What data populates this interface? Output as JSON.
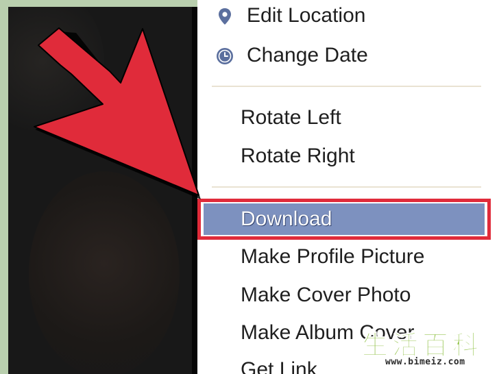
{
  "context_menu": {
    "location_items": [
      {
        "label": "Edit Location",
        "icon": "map-pin-icon"
      },
      {
        "label": "Change Date",
        "icon": "clock-icon"
      }
    ],
    "rotate_items": [
      {
        "label": "Rotate Left"
      },
      {
        "label": "Rotate Right"
      }
    ],
    "highlighted_item": {
      "label": "Download",
      "state": "selected"
    },
    "more_items": [
      {
        "label": "Make Profile Picture"
      },
      {
        "label": "Make Cover Photo"
      },
      {
        "label": "Make Album Cover"
      },
      {
        "label": "Get Link"
      }
    ]
  },
  "annotation": {
    "arrow_color": "#e02b3a",
    "highlight_border_color": "#e02b3a"
  },
  "colors": {
    "selected_background": "#7d91bf",
    "menu_text": "#1f1f1f",
    "background": "#b9cfae"
  },
  "watermark": {
    "cjk": "生活百科",
    "url": "www.bimeiz.com"
  }
}
